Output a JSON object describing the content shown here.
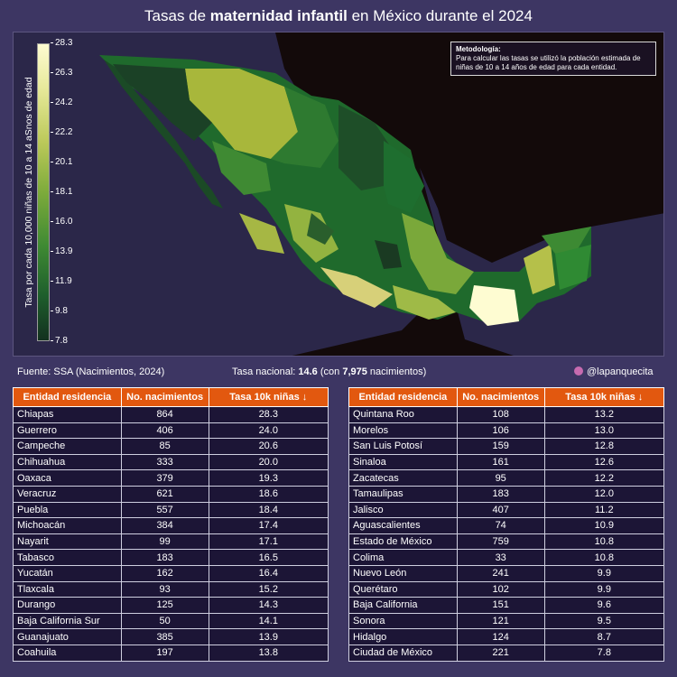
{
  "title_prefix": "Tasas de ",
  "title_bold": "maternidad infantil",
  "title_suffix": " en México durante el 2024",
  "methodology": {
    "title": "Metodología:",
    "text": "Para calcular las tasas se utilizó la población estimada de niñas de 10 a 14 años de edad para cada entidad."
  },
  "colorbar": {
    "label": "Tasa por cada 10,000 niñas de 10 a 14 aSnos de edad",
    "ticks": [
      "28.3",
      "26.3",
      "24.2",
      "22.2",
      "20.1",
      "18.1",
      "16.0",
      "13.9",
      "11.9",
      "9.8",
      "7.8"
    ],
    "min": 7.8,
    "max": 28.3
  },
  "footer": {
    "source": "Fuente: SSA (Nacimientos, 2024)",
    "national_prefix": "Tasa nacional: ",
    "national_rate": "14.6",
    "national_mid": " (con ",
    "national_births": "7,975",
    "national_suffix": " nacimientos)",
    "handle": "@lapanquecita"
  },
  "colors": {
    "background": "#3d3663",
    "map_background": "#130a0a",
    "header": "#e2580f",
    "scale_high": "#fefcd2",
    "scale_low": "#13311f"
  },
  "table_headers": [
    "Entidad residencia",
    "No. nacimientos",
    "Tasa 10k niñas ↓"
  ],
  "chart_data": {
    "type": "table",
    "title": "Tasas de maternidad infantil en México durante el 2024",
    "columns": [
      "Entidad residencia",
      "No. nacimientos",
      "Tasa 10k niñas"
    ],
    "left_rows": [
      [
        "Chiapas",
        "864",
        "28.3"
      ],
      [
        "Guerrero",
        "406",
        "24.0"
      ],
      [
        "Campeche",
        "85",
        "20.6"
      ],
      [
        "Chihuahua",
        "333",
        "20.0"
      ],
      [
        "Oaxaca",
        "379",
        "19.3"
      ],
      [
        "Veracruz",
        "621",
        "18.6"
      ],
      [
        "Puebla",
        "557",
        "18.4"
      ],
      [
        "Michoacán",
        "384",
        "17.4"
      ],
      [
        "Nayarit",
        "99",
        "17.1"
      ],
      [
        "Tabasco",
        "183",
        "16.5"
      ],
      [
        "Yucatán",
        "162",
        "16.4"
      ],
      [
        "Tlaxcala",
        "93",
        "15.2"
      ],
      [
        "Durango",
        "125",
        "14.3"
      ],
      [
        "Baja California Sur",
        "50",
        "14.1"
      ],
      [
        "Guanajuato",
        "385",
        "13.9"
      ],
      [
        "Coahuila",
        "197",
        "13.8"
      ]
    ],
    "right_rows": [
      [
        "Quintana Roo",
        "108",
        "13.2"
      ],
      [
        "Morelos",
        "106",
        "13.0"
      ],
      [
        "San Luis Potosí",
        "159",
        "12.8"
      ],
      [
        "Sinaloa",
        "161",
        "12.6"
      ],
      [
        "Zacatecas",
        "95",
        "12.2"
      ],
      [
        "Tamaulipas",
        "183",
        "12.0"
      ],
      [
        "Jalisco",
        "407",
        "11.2"
      ],
      [
        "Aguascalientes",
        "74",
        "10.9"
      ],
      [
        "Estado de México",
        "759",
        "10.8"
      ],
      [
        "Colima",
        "33",
        "10.8"
      ],
      [
        "Nuevo León",
        "241",
        "9.9"
      ],
      [
        "Querétaro",
        "102",
        "9.9"
      ],
      [
        "Baja California",
        "151",
        "9.6"
      ],
      [
        "Sonora",
        "121",
        "9.5"
      ],
      [
        "Hidalgo",
        "124",
        "8.7"
      ],
      [
        "Ciudad de México",
        "221",
        "7.8"
      ]
    ]
  }
}
